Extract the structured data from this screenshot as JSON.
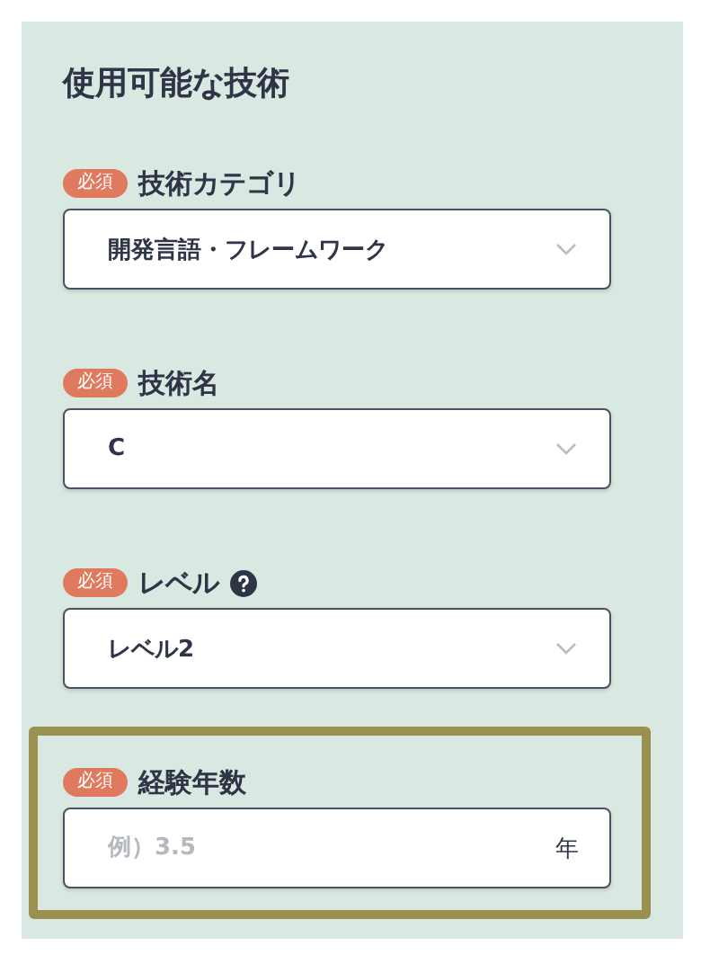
{
  "section_title": "使用可能な技術",
  "fields": [
    {
      "kind": "select",
      "badge": "必須",
      "label": "技術カテゴリ",
      "help": false,
      "value": "開発言語・フレームワーク",
      "highlighted": false
    },
    {
      "kind": "select",
      "badge": "必須",
      "label": "技術名",
      "help": false,
      "value": "C",
      "highlighted": false
    },
    {
      "kind": "select",
      "badge": "必須",
      "label": "レベル",
      "help": true,
      "value": "レベル2",
      "highlighted": false
    },
    {
      "kind": "input",
      "badge": "必須",
      "label": "経験年数",
      "help": false,
      "placeholder": "例）3.5",
      "unit": "年",
      "highlighted": true
    }
  ]
}
